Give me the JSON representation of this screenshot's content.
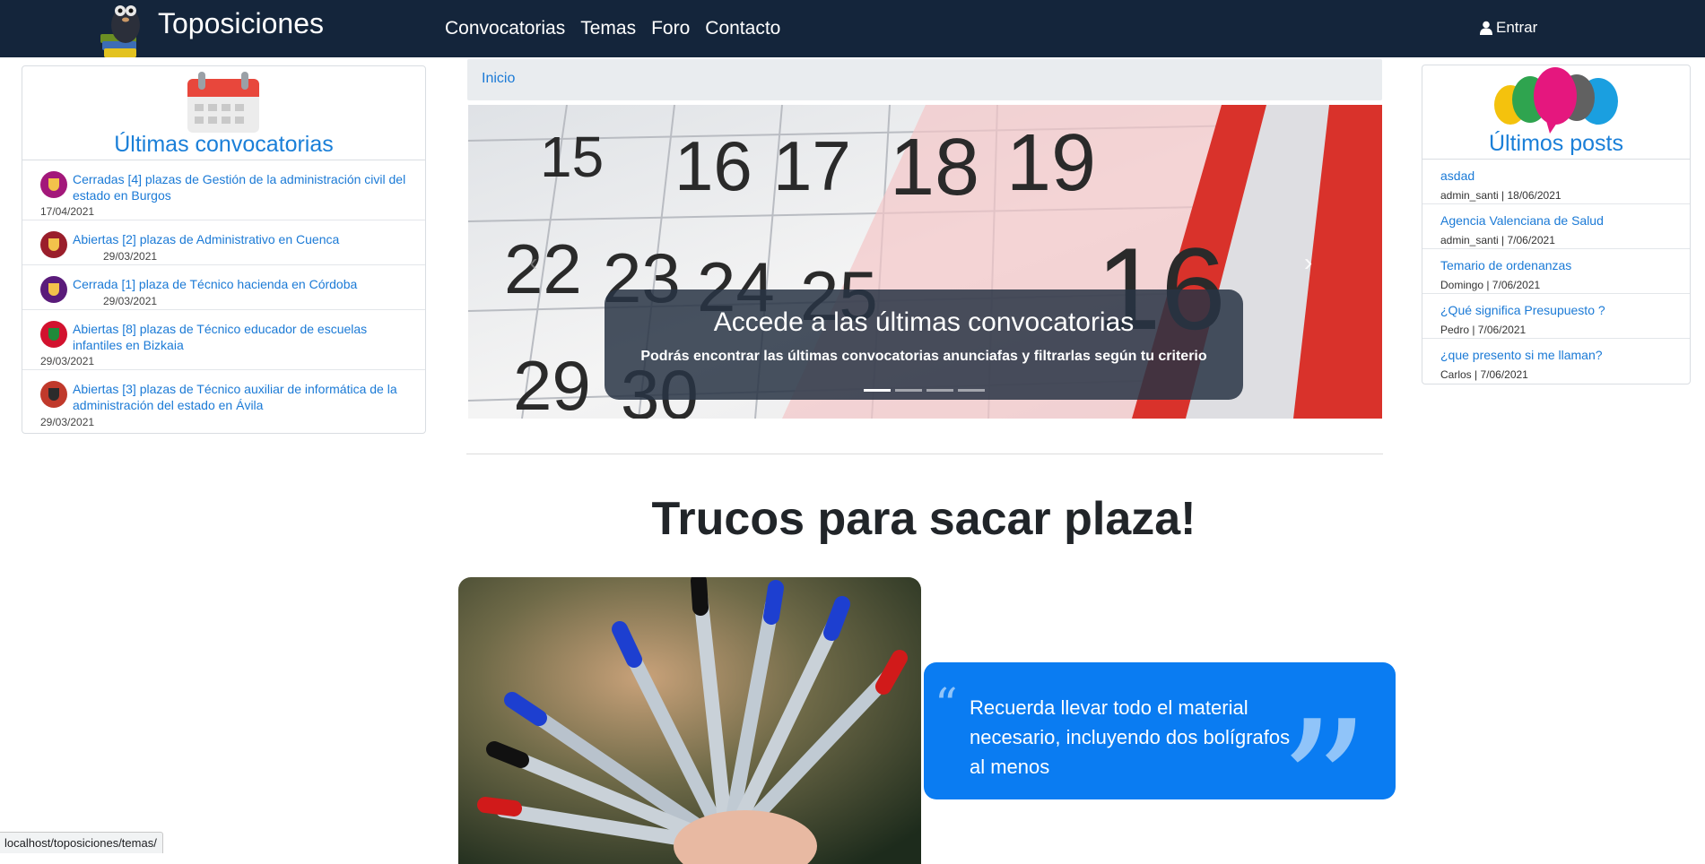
{
  "navbar": {
    "brand": "Toposiciones",
    "links": [
      "Convocatorias",
      "Temas",
      "Foro",
      "Contacto"
    ],
    "login": "Entrar"
  },
  "left_card": {
    "title": "Últimas convocatorias",
    "items": [
      {
        "text": "Cerradas [4] plazas de Gestión de la administración civil del estado en Burgos",
        "date": "17/04/2021",
        "color": "#a3187a"
      },
      {
        "text": "Abiertas [2] plazas de Administrativo en Cuenca",
        "date": "29/03/2021",
        "color": "#9a1e2b"
      },
      {
        "text": "Cerrada [1] plaza de Técnico hacienda en Córdoba",
        "date": "29/03/2021",
        "color": "#5a1b7a"
      },
      {
        "text": "Abiertas [8] plazas de Técnico educador de escuelas infantiles en Bizkaia",
        "date": "29/03/2021",
        "color": "#d2122e"
      },
      {
        "text": "Abiertas [3] plazas de Técnico auxiliar de informática de la administración del estado en Ávila",
        "date": "29/03/2021",
        "color": "#c0392b"
      }
    ]
  },
  "breadcrumb": {
    "home": "Inicio"
  },
  "carousel": {
    "title": "Accede a las últimas convocatorias",
    "subtitle": "Podrás encontrar las últimas convocatorias anunciafas y filtrarlas según tu criterio",
    "slides": 4,
    "active": 0
  },
  "right_card": {
    "title": "Últimos posts",
    "posts": [
      {
        "title": "asdad",
        "meta": "admin_santi | 18/06/2021"
      },
      {
        "title": "Agencia Valenciana de Salud",
        "meta": "admin_santi | 7/06/2021"
      },
      {
        "title": "Temario de ordenanzas",
        "meta": "Domingo | 7/06/2021"
      },
      {
        "title": "¿Qué significa Presupuesto ?",
        "meta": "Pedro | 7/06/2021"
      },
      {
        "title": "¿que presento si me llaman?",
        "meta": "Carlos | 7/06/2021"
      }
    ]
  },
  "section": {
    "heading": "Trucos para sacar plaza!",
    "quote": "Recuerda llevar todo el material necesario, incluyendo dos bolígrafos al menos"
  },
  "status_url": "localhost/toposiciones/temas/",
  "colors": {
    "navbar": "#14253b",
    "link": "#1b7ad6",
    "quote_bg": "#0a7cf2"
  }
}
